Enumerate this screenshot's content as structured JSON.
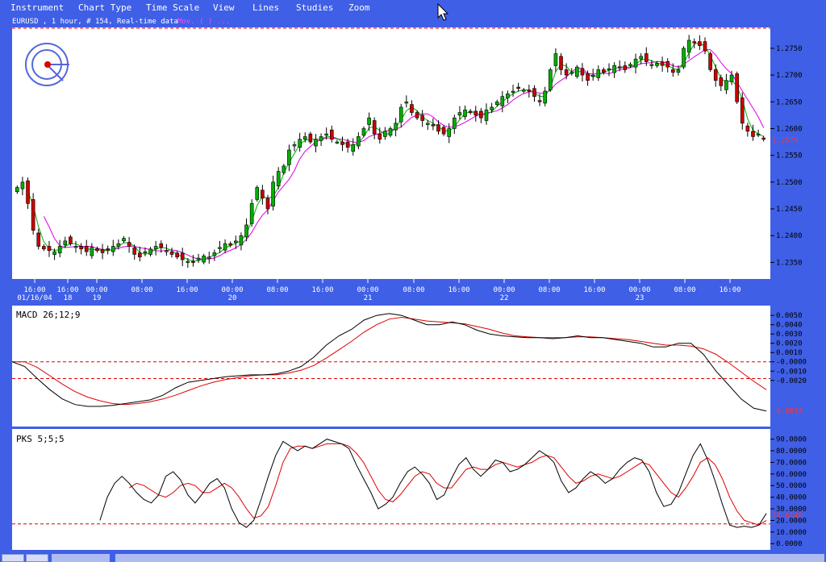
{
  "menu": [
    "Instrument",
    "Chart Type",
    "Time Scale",
    "View",
    "Lines",
    "Studies",
    "Zoom"
  ],
  "colors": {
    "background": "#3f5fe6",
    "panel": "#ffffff",
    "up_candle": "#00b000",
    "down_candle": "#cc0000",
    "ma_fast": "#00b000",
    "ma_slow": "#dd00dd",
    "macd": "#000000",
    "signal": "#dd0000",
    "level": "#dd0000"
  },
  "chart_data": [
    {
      "type": "candlestick",
      "header": "EURUSD , 1 hour, # 154, Real-time data",
      "header_overlay": "Mov. ( ) ...",
      "ylim": [
        1.2325,
        1.278
      ],
      "y_ticks": [
        "1.2750",
        "1.2700",
        "1.2650",
        "1.2600",
        "1.2550",
        "1.2500",
        "1.2450",
        "1.2400",
        "1.2350"
      ],
      "last_price": "1.2579",
      "time_labels": [
        "16:00",
        "16:00",
        "00:00",
        "08:00",
        "16:00",
        "00:00",
        "08:00",
        "16:00",
        "00:00",
        "08:00",
        "16:00",
        "00:00",
        "08:00",
        "16:00",
        "00:00",
        "08:00",
        "16:00"
      ],
      "date_labels": [
        "01/16/04",
        "18",
        "19",
        "20",
        "21",
        "22",
        "23"
      ],
      "close": [
        1.249,
        1.25,
        1.246,
        1.241,
        1.238,
        1.2375,
        1.2372,
        1.237,
        1.238,
        1.239,
        1.2385,
        1.238,
        1.2375,
        1.237,
        1.2378,
        1.2372,
        1.2368,
        1.2375,
        1.238,
        1.2385,
        1.2395,
        1.238,
        1.2365,
        1.236,
        1.237,
        1.2375,
        1.238,
        1.2378,
        1.2372,
        1.2365,
        1.236,
        1.2355,
        1.2352,
        1.235,
        1.2358,
        1.2362,
        1.236,
        1.2368,
        1.2378,
        1.2385,
        1.2382,
        1.239,
        1.24,
        1.242,
        1.246,
        1.249,
        1.247,
        1.245,
        1.25,
        1.252,
        1.253,
        1.256,
        1.257,
        1.258,
        1.2585,
        1.2575,
        1.258,
        1.2585,
        1.259,
        1.258,
        1.2575,
        1.257,
        1.2565,
        1.257,
        1.2585,
        1.26,
        1.262,
        1.259,
        1.258,
        1.2595,
        1.26,
        1.261,
        1.264,
        1.265,
        1.263,
        1.262,
        1.2615,
        1.261,
        1.2605,
        1.2595,
        1.259,
        1.26,
        1.262,
        1.263,
        1.2635,
        1.263,
        1.2625,
        1.262,
        1.2635,
        1.264,
        1.265,
        1.266,
        1.2665,
        1.267,
        1.2675,
        1.2672,
        1.267,
        1.266,
        1.265,
        1.267,
        1.271,
        1.274,
        1.271,
        1.27,
        1.2705,
        1.2715,
        1.27,
        1.269,
        1.27,
        1.271,
        1.2705,
        1.2712,
        1.2718,
        1.2715,
        1.271,
        1.272,
        1.273,
        1.2735,
        1.2725,
        1.272,
        1.2722,
        1.2718,
        1.2715,
        1.2705,
        1.271,
        1.275,
        1.2765,
        1.276,
        1.2755,
        1.2745,
        1.271,
        1.269,
        1.268,
        1.269,
        1.27,
        1.265,
        1.261,
        1.2595,
        1.2585,
        1.259,
        1.258
      ]
    },
    {
      "type": "line",
      "label": "MACD 26;12;9",
      "ylim": [
        -0.0068,
        0.0058
      ],
      "y_ticks": [
        "0.0050",
        "0.0040",
        "0.0030",
        "0.0020",
        "0.0010",
        "-0.0000",
        "-0.0010",
        "-0.0020"
      ],
      "last_value": "-0.0033",
      "levels": [
        0.0,
        -0.0018
      ],
      "series": [
        {
          "name": "MACD",
          "values": [
            0.0,
            -0.0005,
            -0.0018,
            -0.003,
            -0.004,
            -0.0046,
            -0.0048,
            -0.0048,
            -0.0047,
            -0.0045,
            -0.0043,
            -0.0041,
            -0.0036,
            -0.0028,
            -0.0022,
            -0.002,
            -0.0018,
            -0.0016,
            -0.0015,
            -0.0014,
            -0.0014,
            -0.0013,
            -0.001,
            -0.0005,
            0.0005,
            0.0018,
            0.0028,
            0.0035,
            0.0045,
            0.005,
            0.0052,
            0.005,
            0.0045,
            0.004,
            0.004,
            0.0043,
            0.004,
            0.0034,
            0.003,
            0.0028,
            0.0027,
            0.0026,
            0.0026,
            0.0025,
            0.0026,
            0.0028,
            0.0026,
            0.0026,
            0.0024,
            0.0022,
            0.002,
            0.0016,
            0.0016,
            0.002,
            0.002,
            0.0008,
            -0.001,
            -0.0025,
            -0.004,
            -0.005,
            -0.0053
          ]
        },
        {
          "name": "Signal",
          "values": [
            0.0,
            0.0,
            -0.0006,
            -0.0015,
            -0.0024,
            -0.0032,
            -0.0038,
            -0.0042,
            -0.0045,
            -0.0046,
            -0.0045,
            -0.0043,
            -0.004,
            -0.0036,
            -0.0031,
            -0.0026,
            -0.0022,
            -0.0019,
            -0.0017,
            -0.0015,
            -0.0014,
            -0.0014,
            -0.0012,
            -0.0009,
            -0.0004,
            0.0004,
            0.0013,
            0.0022,
            0.0032,
            0.004,
            0.0046,
            0.0048,
            0.0046,
            0.0044,
            0.0043,
            0.0042,
            0.0041,
            0.0038,
            0.0035,
            0.0031,
            0.0028,
            0.0027,
            0.0026,
            0.0026,
            0.0026,
            0.0027,
            0.0027,
            0.0026,
            0.0025,
            0.0024,
            0.0022,
            0.002,
            0.0018,
            0.0018,
            0.0017,
            0.0014,
            0.0008,
            -0.0001,
            -0.0011,
            -0.0021,
            -0.003
          ]
        }
      ]
    },
    {
      "type": "line",
      "label": "PKS 5;5;5",
      "ylim": [
        -4,
        96
      ],
      "y_ticks": [
        "90.0000",
        "80.0000",
        "70.0000",
        "60.0000",
        "50.0000",
        "40.0000",
        "30.0000",
        "20.0000",
        "10.0000",
        "0.0000"
      ],
      "last_value": "24.6146",
      "level": 17,
      "series": [
        {
          "name": "%K",
          "values": [
            null,
            null,
            null,
            null,
            null,
            null,
            null,
            null,
            null,
            null,
            null,
            null,
            20,
            40,
            52,
            58,
            52,
            44,
            38,
            35,
            42,
            58,
            62,
            55,
            42,
            35,
            43,
            52,
            56,
            48,
            30,
            18,
            14,
            20,
            38,
            58,
            76,
            88,
            84,
            80,
            84,
            82,
            86,
            90,
            88,
            86,
            82,
            68,
            56,
            44,
            30,
            34,
            40,
            52,
            62,
            66,
            60,
            52,
            38,
            42,
            56,
            68,
            74,
            64,
            58,
            64,
            72,
            70,
            62,
            64,
            68,
            74,
            80,
            76,
            70,
            54,
            44,
            48,
            56,
            62,
            58,
            52,
            56,
            64,
            70,
            74,
            72,
            62,
            44,
            32,
            34,
            44,
            60,
            76,
            86,
            72,
            54,
            34,
            16,
            14,
            15,
            14,
            16,
            26
          ]
        },
        {
          "name": "%D",
          "values": [
            null,
            null,
            null,
            null,
            null,
            null,
            null,
            null,
            null,
            null,
            null,
            null,
            null,
            null,
            null,
            null,
            48,
            52,
            50,
            46,
            42,
            40,
            44,
            50,
            52,
            50,
            44,
            44,
            48,
            52,
            48,
            40,
            30,
            22,
            24,
            32,
            50,
            70,
            82,
            84,
            84,
            82,
            84,
            86,
            86,
            86,
            84,
            78,
            70,
            58,
            46,
            38,
            36,
            42,
            50,
            58,
            62,
            60,
            52,
            48,
            48,
            56,
            64,
            66,
            64,
            64,
            68,
            70,
            68,
            66,
            68,
            70,
            74,
            76,
            74,
            66,
            58,
            52,
            54,
            58,
            60,
            58,
            56,
            58,
            62,
            66,
            70,
            68,
            60,
            52,
            44,
            40,
            48,
            58,
            70,
            74,
            68,
            56,
            40,
            28,
            20,
            18,
            16,
            20
          ]
        }
      ]
    }
  ]
}
